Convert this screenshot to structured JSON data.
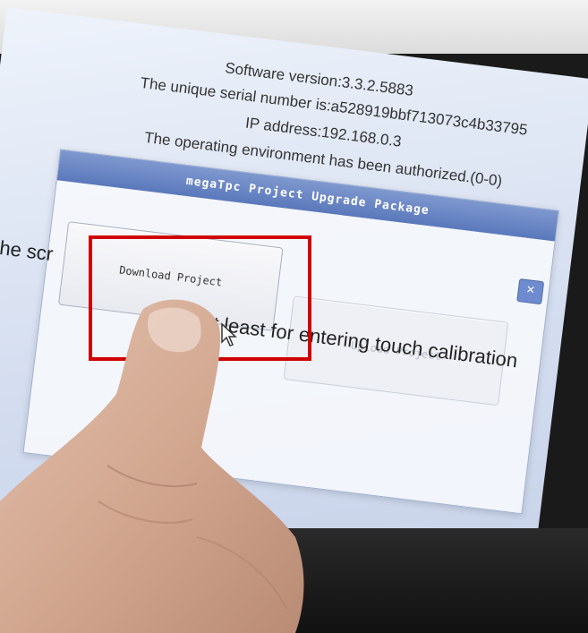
{
  "system_info": {
    "software_version": "Software version:3.3.2.5883",
    "serial_number": "The unique serial number is:a528919bbf713073c4b33795",
    "ip_address": "IP address:192.168.0.3",
    "authorization": "The operating environment has been authorized.(0-0)"
  },
  "dialog": {
    "title": "megaTpc Project Upgrade Package",
    "close_label": "×",
    "download_button_label": "Download Project",
    "upload_button_label": "Upload Project"
  },
  "background_text": {
    "line_1": "d the scr",
    "line_2": "ds at least for entering touch calibration"
  },
  "colors": {
    "highlight": "#d10000",
    "titlebar": "#5a78bb"
  }
}
